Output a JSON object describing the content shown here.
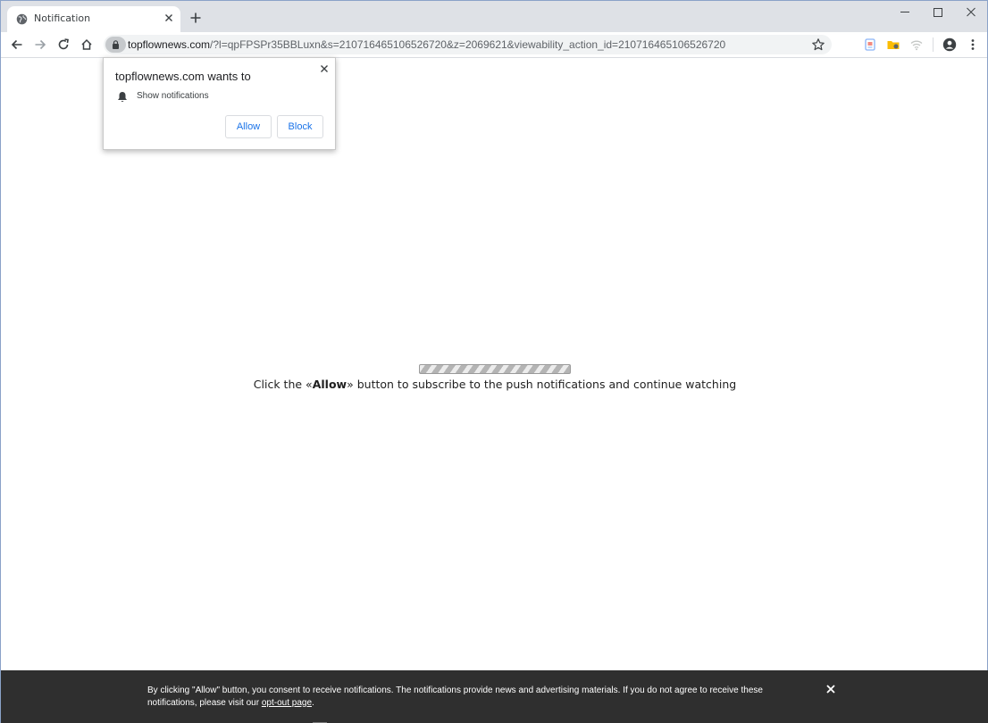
{
  "tab": {
    "title": "Notification"
  },
  "toolbar": {
    "url_host": "topflownews.com",
    "url_rest": "/?l=qpFPSPr35BBLuxn&s=210716465106526720&z=2069621&viewability_action_id=210716465106526720"
  },
  "permission_popup": {
    "title": "topflownews.com wants to",
    "item": "Show notifications",
    "allow_label": "Allow",
    "block_label": "Block"
  },
  "page": {
    "message_before": "Click the «",
    "message_bold": "Allow",
    "message_after": "» button to subscribe to the push notifications and continue watching"
  },
  "consent_bar": {
    "text_before": "By clicking \"Allow\" button, you consent to receive notifications. The notifications provide news and advertising materials. If you do not agree to receive these notifications, please visit our ",
    "link_text": "opt-out page",
    "text_after": "."
  },
  "icons": {
    "favicon": "globe-icon",
    "tab_close": "close-icon",
    "new_tab": "plus-icon",
    "back": "back-arrow-icon",
    "forward": "forward-arrow-icon",
    "reload": "reload-icon",
    "home": "home-icon",
    "lock": "lock-icon",
    "star": "star-icon",
    "profile": "profile-icon",
    "menu": "kebab-menu-icon",
    "bell": "bell-icon"
  },
  "colors": {
    "accent": "#1a73e8",
    "consent_bg": "#2f2f2f",
    "tabstrip_bg": "#dee1e6"
  }
}
